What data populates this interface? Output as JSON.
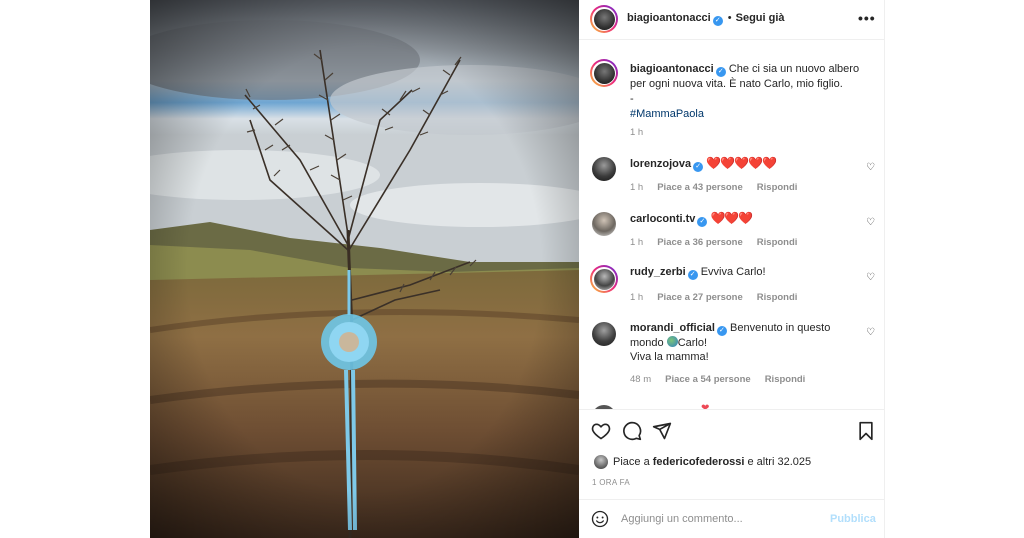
{
  "post": {
    "author": "biagioantonacci",
    "follow_label": "Segui già",
    "more_label": "•••",
    "caption": "Che ci sia un nuovo albero per ogni nuova vita. È nato Carlo, mio figlio.",
    "caption_sep": "-",
    "hashtag": "#MammaPaola",
    "caption_time": "1 h"
  },
  "comments": [
    {
      "user": "lorenzojova",
      "text": "❤️❤️❤️❤️❤️",
      "time": "1 h",
      "likes": "Piace a 43 persone",
      "reply": "Rispondi"
    },
    {
      "user": "carloconti.tv",
      "text": "❤️❤️❤️",
      "time": "1 h",
      "likes": "Piace a 36 persone",
      "reply": "Rispondi"
    },
    {
      "user": "rudy_zerbi",
      "text": "Evviva Carlo!",
      "time": "1 h",
      "likes": "Piace a 27 persone",
      "reply": "Rispondi"
    },
    {
      "user": "morandi_official",
      "text_line1": "Benvenuto in questo",
      "text_line2a": "mondo ",
      "text_line2b": "Carlo!",
      "text_line3": "Viva la mamma!",
      "time": "48 m",
      "likes": "Piace a 54 persone",
      "reply": "Rispondi"
    }
  ],
  "likes_summary": {
    "prefix": "Piace a ",
    "user": "federicofederossi",
    "suffix": " e altri 32.025"
  },
  "post_age": "1 ORA FA",
  "comment_input": {
    "placeholder": "Aggiungi un commento...",
    "publish_label": "Pubblica"
  },
  "colors": {
    "verified": "#3897f0",
    "hashtag": "#00376b",
    "publish": "#b2dffc",
    "secondary_text": "#8e8e8e"
  }
}
